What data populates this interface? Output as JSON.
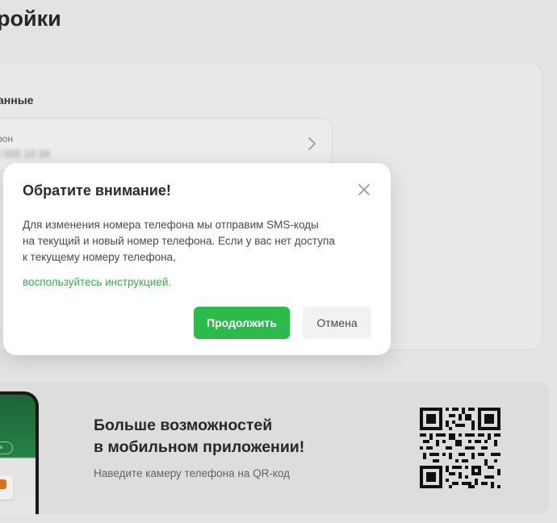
{
  "page": {
    "title": "ройки"
  },
  "settings": {
    "section_title": "анные",
    "phone_label": "рон",
    "phone_value": ") 000 10 34"
  },
  "modal": {
    "title": "Обратите внимание!",
    "body_lines": [
      "Для изменения номера телефона мы отправим SMS-коды",
      "на текущий и новый номер телефона. Если у вас нет доступа",
      "к текущему номеру телефона,"
    ],
    "link_text": "воспользуйтесь инструкцией.",
    "continue_label": "Продолжить",
    "cancel_label": "Отмена",
    "close_icon": "close-icon"
  },
  "promo": {
    "title_lines": [
      "Больше возможностей",
      "в мобильном приложении!"
    ],
    "subtitle": "Наведите камеру телефона на QR-код",
    "phone_button_label": "Вывести",
    "qr_icon": "qr-code"
  },
  "colors": {
    "accent_green": "#2bbb4b",
    "link_green": "#2db34a",
    "background": "#f2f2f2",
    "modal_bg": "#ffffff"
  }
}
